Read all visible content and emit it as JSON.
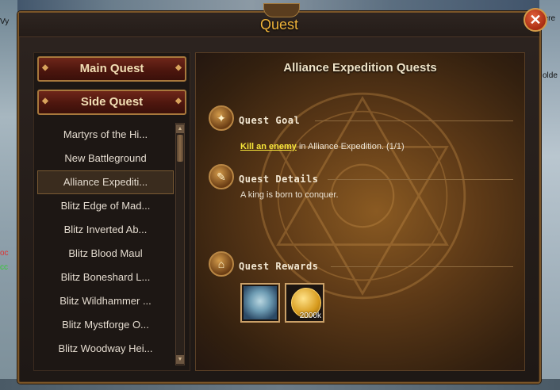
{
  "background": {
    "side_texts": [
      "Vy",
      "pere",
      "olde",
      "oc",
      "cc"
    ]
  },
  "window": {
    "title": "Quest",
    "close_symbol": "✕"
  },
  "tabs": {
    "main_quest": "Main Quest",
    "side_quest": "Side Quest"
  },
  "quest_list": {
    "items": [
      "Martyrs of the Hi...",
      "New Battleground",
      "Alliance Expediti...",
      "Blitz Edge of Mad...",
      "Blitz Inverted Ab...",
      "Blitz Blood Maul",
      "Blitz Boneshard L...",
      "Blitz Wildhammer ...",
      "Blitz Mystforge O...",
      "Blitz Woodway Hei..."
    ],
    "active_index": 2,
    "scroll_up": "▲",
    "scroll_down": "▼"
  },
  "detail": {
    "title": "Alliance Expedition Quests",
    "goal_label": "Quest Goal",
    "goal_link": "Kill an enemy",
    "goal_text": "in Alliance Expedition. (1/1)",
    "details_label": "Quest Details",
    "details_text": "A king is born to conquer.",
    "rewards_label": "Quest Rewards",
    "rewards": [
      {
        "icon": "hero-portrait-icon",
        "amount": ""
      },
      {
        "icon": "gold-coin-icon",
        "amount": "2000k"
      }
    ]
  },
  "colors": {
    "title_gold": "#f0b43a",
    "link_yellow": "#f7e63a",
    "tab_red": "#6e2619"
  }
}
